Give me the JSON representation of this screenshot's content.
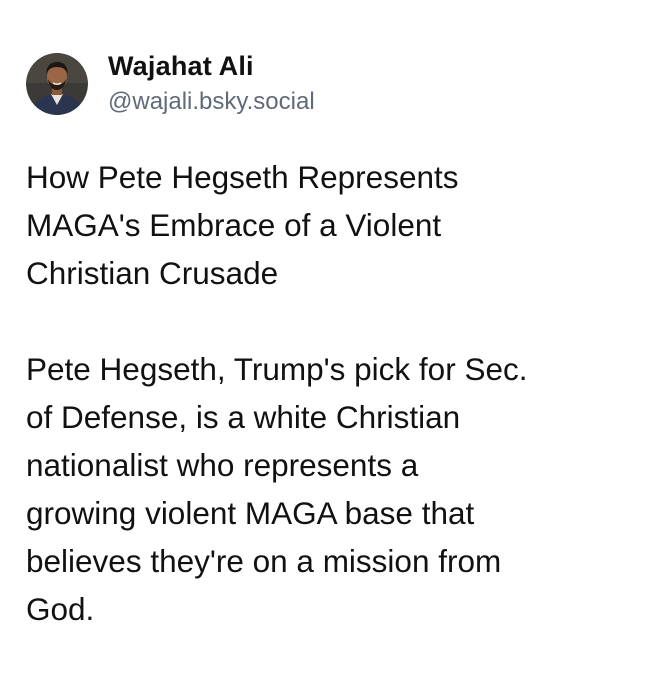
{
  "author": {
    "display_name": "Wajahat Ali",
    "handle": "@wajali.bsky.social",
    "avatar_icon": "avatar-photo-icon"
  },
  "post": {
    "title": "How Pete Hegseth Represents\nMAGA's Embrace of a Violent\nChristian Crusade",
    "body": "Pete Hegseth, Trump's pick for Sec.\nof Defense, is a white Christian\nnationalist who represents a\ngrowing violent MAGA base that\nbelieves they're on a mission from\nGod."
  },
  "colors": {
    "background": "#ffffff",
    "text": "#111111",
    "handle": "#5f6b7a"
  }
}
